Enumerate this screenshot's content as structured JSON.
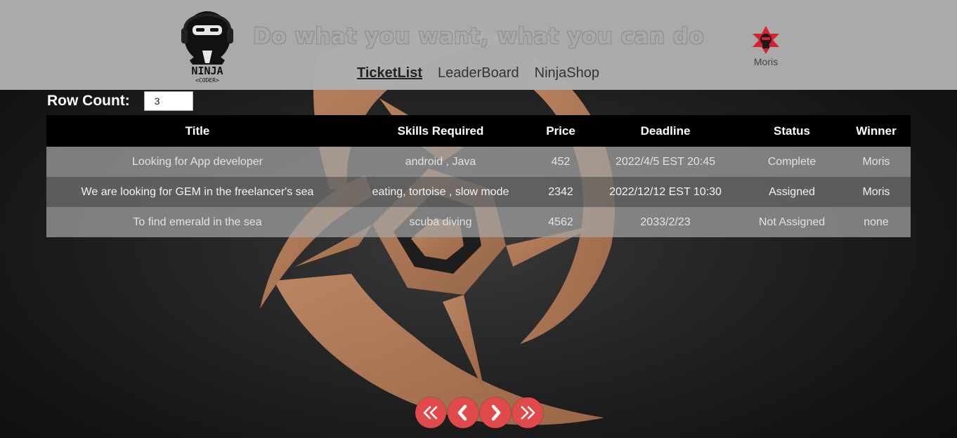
{
  "header": {
    "slogan": "Do what you want, what you can do",
    "logo": {
      "line1": "NINJA",
      "line2": "<CODER>"
    },
    "nav": [
      {
        "label": "TicketList",
        "active": true
      },
      {
        "label": "LeaderBoard",
        "active": false
      },
      {
        "label": "NinjaShop",
        "active": false
      }
    ],
    "user": {
      "name": "Moris",
      "avatar_icon": "red-star-ninja-icon"
    }
  },
  "row_count": {
    "label": "Row Count:",
    "value": "3"
  },
  "table": {
    "headers": [
      "Title",
      "Skills Required",
      "Price",
      "Deadline",
      "Status",
      "Winner"
    ],
    "rows": [
      {
        "title": "Looking for App developer",
        "skills": "android , Java",
        "price": "452",
        "deadline": "2022/4/5 EST 20:45",
        "status": "Complete",
        "winner": "Moris"
      },
      {
        "title": "We are looking for GEM in the freelancer's sea",
        "skills": "eating, tortoise , slow mode",
        "price": "2342",
        "deadline": "2022/12/12 EST 10:30",
        "status": "Assigned",
        "winner": "Moris"
      },
      {
        "title": "To find emerald in the sea",
        "skills": "scuba diving",
        "price": "4562",
        "deadline": "2033/2/23",
        "status": "Not Assigned",
        "winner": "none"
      }
    ]
  },
  "pagination": {
    "buttons": [
      "first-page-icon",
      "prev-page-icon",
      "next-page-icon",
      "last-page-icon"
    ],
    "color": "#e04a4a"
  },
  "colors": {
    "header_bg": "#afafaf",
    "emblem": "#c08a66",
    "avatar_red": "#d8202e"
  }
}
